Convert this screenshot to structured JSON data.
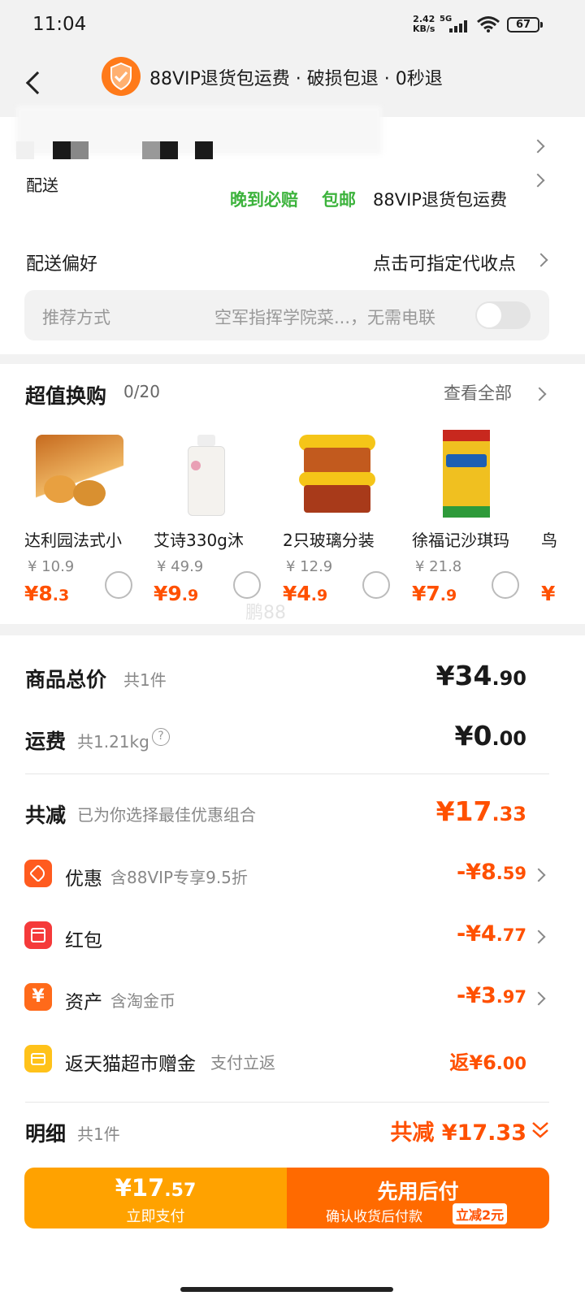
{
  "status_bar": {
    "time": "11:04",
    "net_speed": "2.42",
    "net_unit": "KB/s",
    "net_type": "5G",
    "battery": "67"
  },
  "header": {
    "title": "88VIP退货包运费 · 破损包退 · 0秒退"
  },
  "address": {
    "delivery_label": "配送",
    "tags": [
      "晚到必赔",
      "包邮",
      "88VIP退货包运费"
    ]
  },
  "preference": {
    "label": "配送偏好",
    "action": "点击可指定代收点",
    "recommend_label": "推荐方式",
    "recommend_value": "空军指挥学院菜...，无需电联"
  },
  "exchange": {
    "title": "超值换购",
    "count": "0/20",
    "view_all": "查看全部",
    "items": [
      {
        "name": "达利园法式小",
        "orig": "¥ 10.9",
        "price_int": "¥8",
        "price_dec": ".3"
      },
      {
        "name": "艾诗330g沐",
        "orig": "¥ 49.9",
        "price_int": "¥9",
        "price_dec": ".9"
      },
      {
        "name": "2只玻璃分装",
        "orig": "¥ 12.9",
        "price_int": "¥4",
        "price_dec": ".9"
      },
      {
        "name": "徐福记沙琪玛",
        "orig": "¥ 21.8",
        "price_int": "¥7",
        "price_dec": ".9"
      }
    ],
    "partial_name": "鸟",
    "partial_price": "¥"
  },
  "watermark": "鹏88",
  "summary": {
    "total_label": "商品总价",
    "total_count": "共1件",
    "total_int": "¥34",
    "total_dec": ".90",
    "freight_label": "运费",
    "freight_weight": "共1.21kg",
    "freight_int": "¥0",
    "freight_dec": ".00",
    "reduce_label": "共减",
    "reduce_sub": "已为你选择最佳优惠组合",
    "reduce_int": "¥17",
    "reduce_dec": ".33",
    "discounts": [
      {
        "icon": "discount-tag-icon",
        "label": "优惠",
        "sub": "含88VIP专享9.5折",
        "int": "-¥8",
        "dec": ".59"
      },
      {
        "icon": "red-packet-icon",
        "label": "红包",
        "sub": "",
        "int": "-¥4",
        "dec": ".77"
      },
      {
        "icon": "asset-yen-icon",
        "label": "资产",
        "sub": "含淘金币",
        "int": "-¥3",
        "dec": ".97"
      },
      {
        "icon": "gift-box-icon",
        "label": "返天猫超市赠金",
        "sub": "支付立返",
        "int": "返¥6",
        "dec": ".00"
      }
    ],
    "detail_label": "明细",
    "detail_count": "共1件",
    "detail_reduce": "共减 ¥17.33"
  },
  "footer": {
    "pay_int": "¥17",
    "pay_dec": ".57",
    "pay_label": "立即支付",
    "later_title": "先用后付",
    "later_sub": "确认收货后付款",
    "later_badge": "立减2元"
  },
  "colors": {
    "accent": "#ff5000",
    "green": "#3db33d",
    "pay_yellow": "#ffa200",
    "pay_orange": "#ff6a00"
  }
}
